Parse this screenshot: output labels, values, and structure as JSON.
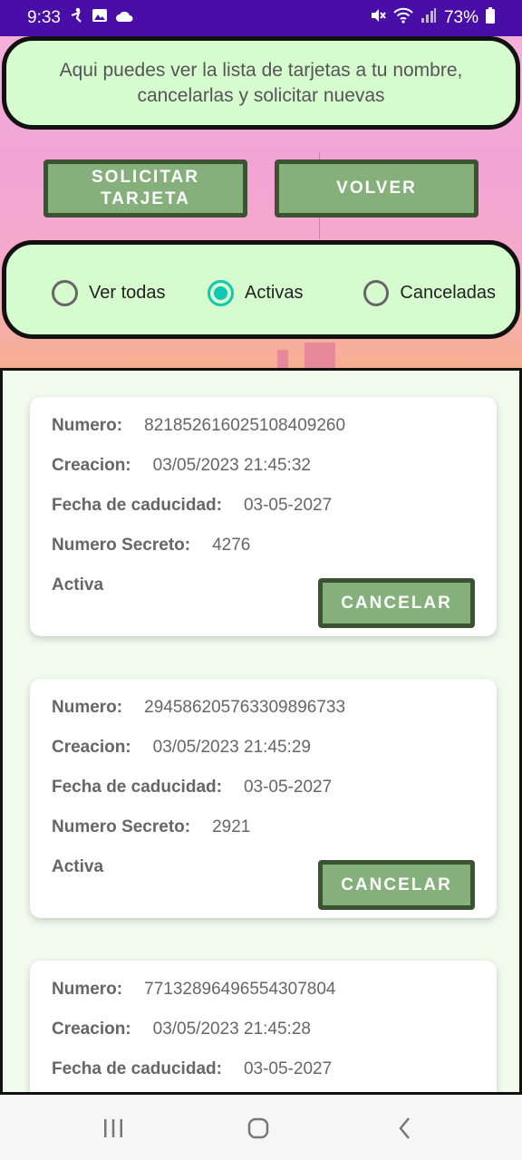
{
  "status_bar": {
    "time": "9:33",
    "battery": "73%",
    "left_icons": [
      "accessibility-icon",
      "image-icon",
      "cloud-icon"
    ],
    "right_icons": [
      "mute-icon",
      "wifi-icon",
      "signal-icon",
      "battery-icon"
    ]
  },
  "header": {
    "info_text": "Aqui puedes ver la lista de tarjetas a tu nombre, cancelarlas y solicitar nuevas"
  },
  "actions": {
    "request_label": "SOLICITAR\nTARJETA",
    "back_label": "VOLVER"
  },
  "filters": {
    "options": [
      {
        "label": "Ver todas",
        "selected": false
      },
      {
        "label": "Activas",
        "selected": true
      },
      {
        "label": "Canceladas",
        "selected": false
      }
    ],
    "accent_color": "#11c6b3"
  },
  "cards": [
    {
      "numero_label": "Numero:",
      "numero": "821852616025108409260",
      "creacion_label": "Creacion:",
      "creacion": "03/05/2023 21:45:32",
      "caducidad_label": "Fecha de caducidad:",
      "caducidad": "03-05-2027",
      "secreto_label": "Numero Secreto:",
      "secreto": "4276",
      "status": "Activa",
      "cancel_label": "CANCELAR"
    },
    {
      "numero_label": "Numero:",
      "numero": "294586205763309896733",
      "creacion_label": "Creacion:",
      "creacion": "03/05/2023 21:45:29",
      "caducidad_label": "Fecha de caducidad:",
      "caducidad": "03-05-2027",
      "secreto_label": "Numero Secreto:",
      "secreto": "2921",
      "status": "Activa",
      "cancel_label": "CANCELAR"
    },
    {
      "numero_label": "Numero:",
      "numero": "77132896496554307804",
      "creacion_label": "Creacion:",
      "creacion": "03/05/2023 21:45:28",
      "caducidad_label": "Fecha de caducidad:",
      "caducidad": "03-05-2027"
    }
  ],
  "colors": {
    "status_bar": "#4a0ea8",
    "panel": "#d6fbcf",
    "button": "#86b07b",
    "button_border": "#3b5233"
  }
}
